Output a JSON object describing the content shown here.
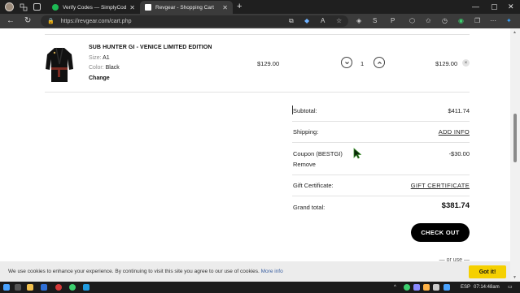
{
  "browser": {
    "tabs": [
      {
        "title": "Verify Codes — SimplyCodes",
        "active": false,
        "favicon_color": "#1db954"
      },
      {
        "title": "Revgear - Shopping Cart",
        "active": true,
        "favicon_color": "#ffffff"
      }
    ],
    "url": "https://revgear.com/cart.php",
    "lock_icon": "lock-icon"
  },
  "cart": {
    "item": {
      "name": "SUB HUNTER GI - VENICE LIMITED EDITION",
      "size_label": "Size:",
      "size_value": "A1",
      "color_label": "Color:",
      "color_value": "Black",
      "change_label": "Change",
      "price": "$129.00",
      "quantity": "1",
      "total": "$129.00",
      "minus_glyph": "‹",
      "plus_glyph": "›",
      "remove_glyph": "×"
    },
    "totals": {
      "subtotal_label": "Subtotal:",
      "subtotal_value": "$411.74",
      "shipping_label": "Shipping:",
      "shipping_link": "ADD INFO",
      "coupon_label": "Coupon (BESTGI)",
      "coupon_value": "-$30.00",
      "coupon_remove": "Remove",
      "gift_label": "Gift Certificate:",
      "gift_link": "GIFT CERTIFICATE",
      "grand_label": "Grand total:",
      "grand_value": "$381.74"
    },
    "checkout_label": "CHECK OUT",
    "or_use": "— or use —"
  },
  "cookie_banner": {
    "text": "We use cookies to enhance your experience. By continuing to visit this site you agree to our use of cookies.",
    "more_info": "More info",
    "button": "Got it!"
  },
  "taskbar": {
    "lang": "ESP",
    "time": "07:14:48am"
  },
  "colors": {
    "accent_button": "#000000",
    "cookie_button": "#f5d000",
    "browser_dark": "#1f1f1f"
  }
}
